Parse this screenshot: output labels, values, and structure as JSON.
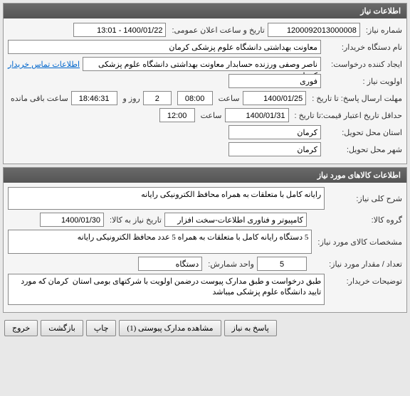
{
  "panel1": {
    "title": "اطلاعات نیاز",
    "need_number_label": "شماره نیاز:",
    "need_number": "1200092013000008",
    "announce_date_label": "تاریخ و ساعت اعلان عمومی:",
    "announce_date": "1400/01/22 - 13:01",
    "buyer_label": "نام دستگاه خریدار:",
    "buyer": "معاونت بهداشتی دانشگاه علوم پزشکی کرمان",
    "creator_label": "ایجاد کننده درخواست:",
    "creator": "ناصر  وصفی ورزنده حسابدار معاونت بهداشتی دانشگاه علوم پزشکی کرمان",
    "contact_link": "اطلاعات تماس خریدار",
    "priority_label": "اولویت نیاز :",
    "priority": "فوری",
    "deadline_label": "مهلت ارسال پاسخ:  تا تاریخ :",
    "deadline_date": "1400/01/25",
    "time_label": "ساعت",
    "deadline_time": "08:00",
    "days": "2",
    "days_label": "روز و",
    "remaining_time": "18:46:31",
    "remaining_label": "ساعت باقی مانده",
    "validity_label": "حداقل تاریخ اعتبار قیمت:",
    "validity_to_label": "تا تاریخ :",
    "validity_date": "1400/01/31",
    "validity_time": "12:00",
    "delivery_province_label": "استان محل تحویل:",
    "delivery_province": "کرمان",
    "delivery_city_label": "شهر محل تحویل:",
    "delivery_city": "کرمان"
  },
  "panel2": {
    "title": "اطلاعات کالاهای مورد نیاز",
    "desc_label": "شرح کلی نیاز:",
    "desc": "رایانه کامل با متعلقات به همراه محافظ الکترونیکی رایانه",
    "group_label": "گروه کالا:",
    "group": "کامپیوتر و فناوری اطلاعات-سخت افزار",
    "need_by_label": "تاریخ نیاز به کالا:",
    "need_by": "1400/01/30",
    "spec_label": "مشخصات کالای مورد نیاز:",
    "spec": "5 دستگاه رایانه کامل با متعلقات به همراه 5 عدد محافظ الکترونیکی رایانه",
    "qty_label": "تعداد / مقدار مورد نیاز:",
    "qty": "5",
    "unit_label": "واحد شمارش:",
    "unit": "دستگاه",
    "notes_label": "توضیحات خریدار:",
    "notes": "طبق درخواست و طبق مدارک پیوست درضمن اولویت با شرکتهای بومی استان  کرمان که مورد تایید دانشگاه علوم پزشکی میباشد"
  },
  "buttons": {
    "respond": "پاسخ به نیاز",
    "attachments": "مشاهده مدارک پیوستی  (1)",
    "print": "چاپ",
    "back": "بازگشت",
    "exit": "خروج"
  }
}
